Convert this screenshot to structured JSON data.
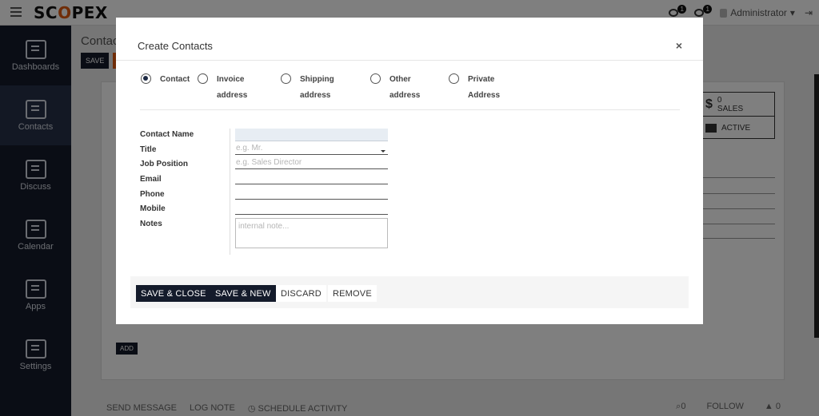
{
  "app": {
    "logo_left": "SC",
    "logo_o": "O",
    "logo_right": "PEX",
    "activity_count": "1",
    "message_count": "1",
    "user_name": "Administrator"
  },
  "sidebar": {
    "items": [
      {
        "label": "Dashboards",
        "icon": "dashboard-icon"
      },
      {
        "label": "Contacts",
        "icon": "contacts-icon"
      },
      {
        "label": "Discuss",
        "icon": "discuss-icon"
      },
      {
        "label": "Calendar",
        "icon": "calendar-icon"
      },
      {
        "label": "Apps",
        "icon": "apps-icon"
      },
      {
        "label": "Settings",
        "icon": "settings-icon"
      }
    ]
  },
  "background": {
    "breadcrumb": "Contac",
    "save_label": "SAVE",
    "sales_count": "0",
    "sales_label": "SALES",
    "active_label": "ACTIVE",
    "add_label": "ADD",
    "chatter": {
      "send_message": "SEND MESSAGE",
      "log_note": "LOG NOTE",
      "schedule_activity": "SCHEDULE ACTIVITY",
      "attachments_count": "0",
      "follow": "FOLLOW",
      "followers_count": "0"
    }
  },
  "modal": {
    "title": "Create Contacts",
    "close": "×",
    "types": [
      {
        "line1": "Contact",
        "line2": "",
        "selected": true
      },
      {
        "line1": "Invoice",
        "line2": "address",
        "selected": false
      },
      {
        "line1": "Shipping",
        "line2": "address",
        "selected": false
      },
      {
        "line1": "Other",
        "line2": "address",
        "selected": false
      },
      {
        "line1": "Private",
        "line2": "Address",
        "selected": false
      }
    ],
    "fields": {
      "contact_name": {
        "label": "Contact Name",
        "value": "",
        "placeholder": ""
      },
      "title": {
        "label": "Title",
        "value": "",
        "placeholder": "e.g. Mr."
      },
      "job_position": {
        "label": "Job Position",
        "value": "",
        "placeholder": "e.g. Sales Director"
      },
      "email": {
        "label": "Email",
        "value": "",
        "placeholder": ""
      },
      "phone": {
        "label": "Phone",
        "value": "",
        "placeholder": ""
      },
      "mobile": {
        "label": "Mobile",
        "value": "",
        "placeholder": ""
      },
      "notes": {
        "label": "Notes",
        "value": "",
        "placeholder": "internal note..."
      }
    },
    "buttons": {
      "save_close": "SAVE & CLOSE",
      "save_new": "SAVE & NEW",
      "discard": "DISCARD",
      "remove": "REMOVE"
    }
  },
  "colors": {
    "sidebar_bg": "#141b2b",
    "primary_button": "#141b2b",
    "brand_orange": "#e05a10"
  }
}
